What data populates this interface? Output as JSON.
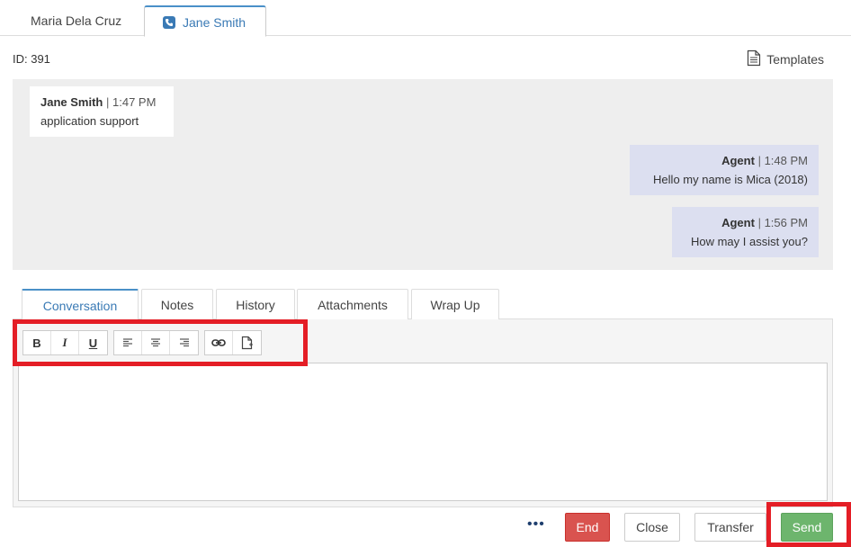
{
  "contact_tabs": [
    {
      "label": "Maria Dela Cruz"
    },
    {
      "label": "Jane Smith",
      "icon": "phone-icon"
    }
  ],
  "session": {
    "id_text": "ID: 391"
  },
  "templates_label": "Templates",
  "messages": [
    {
      "sender": "Jane Smith",
      "time": "1:47 PM",
      "text": "application support",
      "role": "customer"
    },
    {
      "sender": "Agent",
      "time": "1:48 PM",
      "text": "Hello my name is Mica (2018)",
      "role": "agent"
    },
    {
      "sender": "Agent",
      "time": "1:56 PM",
      "text": "How may I assist you?",
      "role": "agent"
    }
  ],
  "separator": "|",
  "panel_tabs": [
    {
      "label": "Conversation"
    },
    {
      "label": "Notes"
    },
    {
      "label": "History"
    },
    {
      "label": "Attachments"
    },
    {
      "label": "Wrap Up"
    }
  ],
  "toolbar": {
    "bold": "B",
    "italic": "I",
    "underline": "U"
  },
  "actions": {
    "more": "•••",
    "end": "End",
    "close": "Close",
    "transfer": "Transfer",
    "send": "Send"
  },
  "colors": {
    "accent": "#3a7ab5",
    "end": "#d9534f",
    "send": "#6db56d",
    "highlight": "#e41e26",
    "agent_bubble": "#dcdff0"
  }
}
